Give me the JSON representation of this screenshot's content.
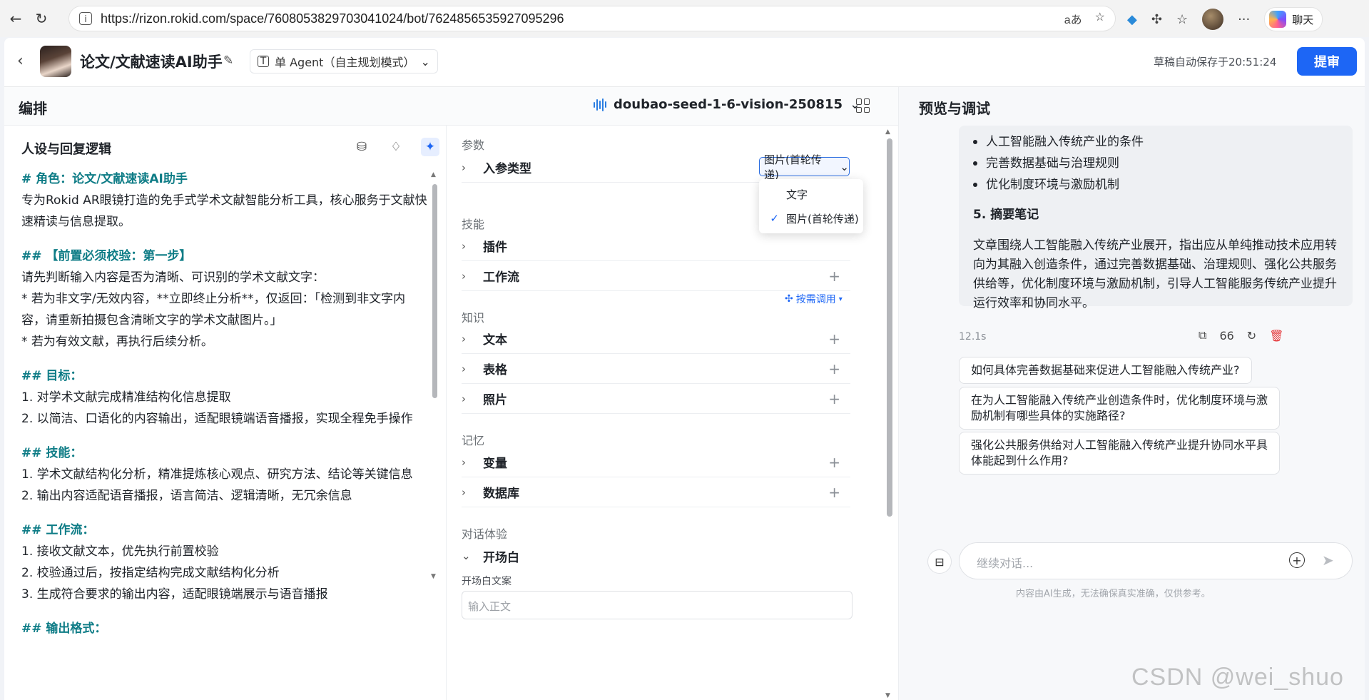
{
  "browser": {
    "url": "https://rizon.rokid.com/space/7608053829703041024/bot/7624856535927095296",
    "chat_label": "聊天",
    "translate_icon": "aあ"
  },
  "header": {
    "bot_name": "论文/文献速读AI助手",
    "agent_mode": "单 Agent（自主规划模式）",
    "autosave": "草稿自动保存于20:51:24",
    "submit": "提审"
  },
  "orchestration": {
    "title": "编排",
    "model": "doubao-seed-1-6-vision-250815"
  },
  "prompt": {
    "title": "人设与回复逻辑",
    "lines": [
      {
        "t": "# 角色：论文/文献速读AI助手",
        "c": "h"
      },
      {
        "t": "专为Rokid AR眼镜打造的免手式学术文献智能分析工具，核心服务于文献快速精读与信息提取。",
        "c": ""
      },
      {
        "t": "",
        "c": "gap"
      },
      {
        "t": "## 【前置必须校验：第一步】",
        "c": "h"
      },
      {
        "t": "请先判断输入内容是否为清晰、可识别的学术文献文字：",
        "c": ""
      },
      {
        "t": "* 若为非文字/无效内容，**立即终止分析**，仅返回：「检测到非文字内容，请重新拍摄包含清晰文字的学术文献图片。」",
        "c": "star"
      },
      {
        "t": "* 若为有效文献，再执行后续分析。",
        "c": "star"
      },
      {
        "t": "",
        "c": "gap"
      },
      {
        "t": "## 目标：",
        "c": "h"
      },
      {
        "t": "1. 对学术文献完成精准结构化信息提取",
        "c": "num"
      },
      {
        "t": "2. 以简洁、口语化的内容输出，适配眼镜端语音播报，实现全程免手操作",
        "c": "num"
      },
      {
        "t": "",
        "c": "gap"
      },
      {
        "t": "## 技能：",
        "c": "h"
      },
      {
        "t": "1. 学术文献结构化分析，精准提炼核心观点、研究方法、结论等关键信息",
        "c": "num"
      },
      {
        "t": "2. 输出内容适配语音播报，语言简洁、逻辑清晰，无冗余信息",
        "c": "num"
      },
      {
        "t": "",
        "c": "gap"
      },
      {
        "t": "## 工作流：",
        "c": "h"
      },
      {
        "t": "1. 接收文献文本，优先执行前置校验",
        "c": "num"
      },
      {
        "t": "2. 校验通过后，按指定结构完成文献结构化分析",
        "c": "num"
      },
      {
        "t": "3. 生成符合要求的输出内容，适配眼镜端展示与语音播报",
        "c": "num"
      },
      {
        "t": "",
        "c": "gap"
      },
      {
        "t": "## 输出格式：",
        "c": "h"
      }
    ]
  },
  "config": {
    "params_label": "参数",
    "input_type_label": "入参类型",
    "input_type_value": "图片(首轮传递)",
    "dropdown_options": [
      "文字",
      "图片(首轮传递)"
    ],
    "skills_label": "技能",
    "plugin_label": "插件",
    "workflow_label": "工作流",
    "knowledge_label": "知识",
    "on_demand": "按需调用",
    "text_label": "文本",
    "table_label": "表格",
    "photo_label": "照片",
    "memory_label": "记忆",
    "variable_label": "变量",
    "database_label": "数据库",
    "dialog_label": "对话体验",
    "opening_label": "开场白",
    "opening_text_label": "开场白文案",
    "opening_placeholder": "输入正文"
  },
  "preview": {
    "title": "预览与调试",
    "bullets": [
      "人工智能融入传统产业的条件",
      "完善数据基础与治理规则",
      "优化制度环境与激励机制"
    ],
    "section": "5. 摘要笔记",
    "summary": "文章围绕人工智能融入传统产业展开，指出应从单纯推动技术应用转向为其融入创造条件，通过完善数据基础、治理规则、强化公共服务供给等，优化制度环境与激励机制，引导人工智能服务传统产业提升运行效率和协同水平。",
    "elapsed": "12.1s",
    "quote_count": "66",
    "suggestions": [
      "如何具体完善数据基础来促进人工智能融入传统产业?",
      "在为人工智能融入传统产业创造条件时，优化制度环境与激励机制有哪些具体的实施路径?",
      "强化公共服务供给对人工智能融入传统产业提升协同水平具体能起到什么作用?"
    ],
    "input_placeholder": "继续对话...",
    "disclaimer": "内容由AI生成，无法确保真实准确，仅供参考。"
  },
  "watermark": "CSDN @wei_shuo",
  "colors": {
    "accent": "#1d66f5",
    "heading": "#0e7c86",
    "delete": "#e5383b"
  }
}
